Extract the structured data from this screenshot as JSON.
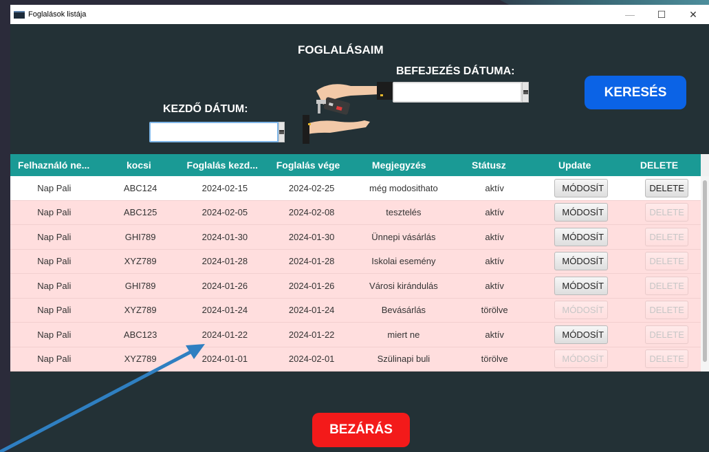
{
  "window": {
    "title": "Foglalások listája"
  },
  "controls": {
    "minimize": "—",
    "maximize": "☐",
    "close": "✕"
  },
  "heading": "FOGLALÁSAIM",
  "start_date": {
    "label": "KEZDŐ DÁTUM:",
    "value": ""
  },
  "end_date": {
    "label": "BEFEJEZÉS DÁTUMA:",
    "value": ""
  },
  "search_button": "KERESÉS",
  "close_button": "BEZÁRÁS",
  "table": {
    "columns": [
      "Felhaználó ne...",
      "kocsi",
      "Foglalás kezd...",
      "Foglalás vége",
      "Megjegyzés",
      "Státusz",
      "Update",
      "DELETE"
    ],
    "update_label": "MÓDOSÍT",
    "delete_label": "DELETE",
    "rows": [
      {
        "user": "Nap Pali",
        "car": "ABC124",
        "start": "2024-02-15",
        "end": "2024-02-25",
        "note": "még modosithato",
        "status": "aktív",
        "update_enabled": true,
        "delete_enabled": true
      },
      {
        "user": "Nap Pali",
        "car": "ABC125",
        "start": "2024-02-05",
        "end": "2024-02-08",
        "note": "tesztelés",
        "status": "aktív",
        "update_enabled": true,
        "delete_enabled": false
      },
      {
        "user": "Nap Pali",
        "car": "GHI789",
        "start": "2024-01-30",
        "end": "2024-01-30",
        "note": "Ünnepi vásárlás",
        "status": "aktív",
        "update_enabled": true,
        "delete_enabled": false
      },
      {
        "user": "Nap Pali",
        "car": "XYZ789",
        "start": "2024-01-28",
        "end": "2024-01-28",
        "note": "Iskolai esemény",
        "status": "aktív",
        "update_enabled": true,
        "delete_enabled": false
      },
      {
        "user": "Nap Pali",
        "car": "GHI789",
        "start": "2024-01-26",
        "end": "2024-01-26",
        "note": "Városi kirándulás",
        "status": "aktív",
        "update_enabled": true,
        "delete_enabled": false
      },
      {
        "user": "Nap Pali",
        "car": "XYZ789",
        "start": "2024-01-24",
        "end": "2024-01-24",
        "note": "Bevásárlás",
        "status": "törölve",
        "update_enabled": false,
        "delete_enabled": false
      },
      {
        "user": "Nap Pali",
        "car": "ABC123",
        "start": "2024-01-22",
        "end": "2024-01-22",
        "note": "miert ne",
        "status": "aktív",
        "update_enabled": true,
        "delete_enabled": false
      },
      {
        "user": "Nap Pali",
        "car": "XYZ789",
        "start": "2024-01-01",
        "end": "2024-02-01",
        "note": "Szülinapi buli",
        "status": "törölve",
        "update_enabled": false,
        "delete_enabled": false
      }
    ]
  },
  "colors": {
    "window_bg": "#233136",
    "header_bg": "#1a9a95",
    "row_bg": "#ffdede",
    "search_button": "#0b63e6",
    "close_button": "#f31a1a",
    "annotation_arrow": "#2f7fc1"
  },
  "icons": {
    "app": "app-icon",
    "calendar": "calendar-icon",
    "illustration": "car-key-handover-illustration",
    "annotation": "annotation-arrow"
  }
}
